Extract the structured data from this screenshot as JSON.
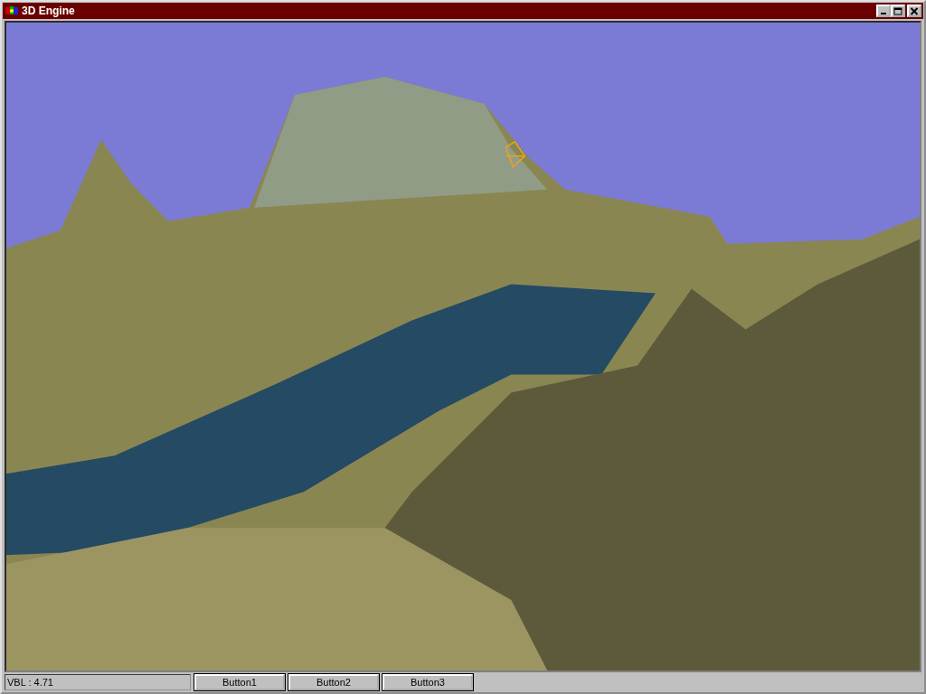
{
  "window": {
    "title": "3D Engine"
  },
  "status_bar": {
    "reading": "VBL : 4.71",
    "buttons": [
      "Button1",
      "Button2",
      "Button3"
    ]
  }
}
